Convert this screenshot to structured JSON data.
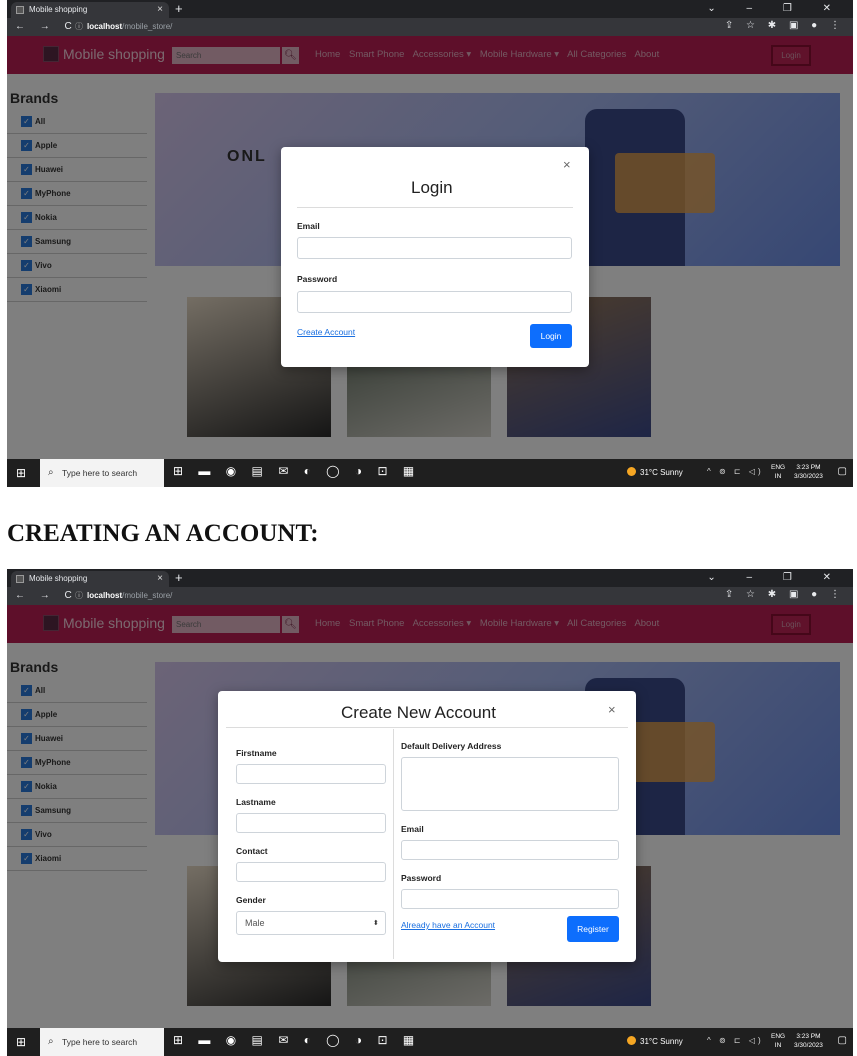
{
  "heading": "CREATING AN ACCOUNT:",
  "browser": {
    "tab_title": "Mobile shopping",
    "tab_close": "×",
    "new_tab": "+",
    "window_controls": "⌄ – ❐ ✕",
    "nav_buttons": "← → C",
    "url_host": "localhost",
    "url_path": "/mobile_store/",
    "url_info": "ⓘ",
    "toolbar_icons": "⇪ ☆ ✱ ▣ ● ⋮"
  },
  "site": {
    "brand": "Mobile shopping",
    "search_placeholder": "Search",
    "search_icon": "magnifier",
    "nav": [
      "Home",
      "Smart Phone",
      "Accessories ▾",
      "Mobile Hardware ▾",
      "All Categories",
      "About"
    ],
    "login_button": "Login",
    "brands_title": "Brands",
    "brands": [
      "All",
      "Apple",
      "Huawei",
      "MyPhone",
      "Nokia",
      "Samsung",
      "Vivo",
      "Xiaomi"
    ],
    "banner_text": "ONL"
  },
  "login_modal": {
    "title": "Login",
    "close": "×",
    "email_label": "Email",
    "password_label": "Password",
    "create_account_link": "Create Account",
    "login_button": "Login"
  },
  "create_modal": {
    "title": "Create New Account",
    "close": "×",
    "firstname_label": "Firstname",
    "lastname_label": "Lastname",
    "contact_label": "Contact",
    "gender_label": "Gender",
    "gender_value": "Male",
    "address_label": "Default Delivery Address",
    "email_label": "Email",
    "password_label": "Password",
    "login_link": "Already have an Account",
    "register_button": "Register"
  },
  "taskbar": {
    "search_text": "Type here to search",
    "app_icons": "⊞ ▬ ◉ ▤ ✉ ◐ ◯ ◑ ⊡ ▦",
    "weather": "31°C  Sunny",
    "tray_icons": "^ ⊚ ⊏ ◁)",
    "lang_line1": "ENG",
    "lang_line2": "IN",
    "time": "3:23 PM",
    "date": "3/30/2023",
    "notify_icon": "▢"
  }
}
